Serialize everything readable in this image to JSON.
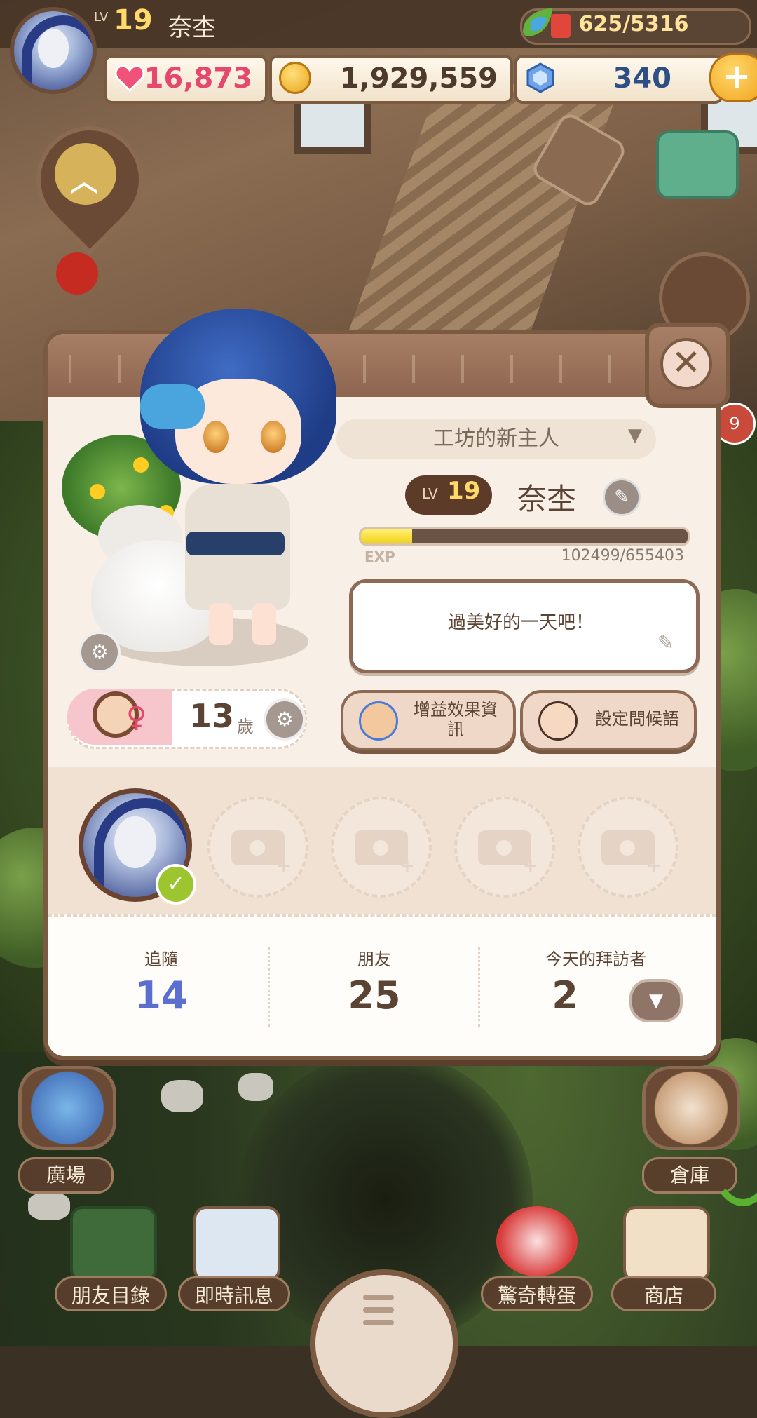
{
  "hud": {
    "level_prefix": "LV",
    "level": "19",
    "player_name": "奈杢",
    "energy": "625/5316",
    "energy_fraction": 0.117,
    "hearts": "16,873",
    "coins": "1,929,559",
    "gems": "340",
    "add_label": "+"
  },
  "profile": {
    "title": "工坊的新主人",
    "level_prefix": "LV",
    "level": "19",
    "name": "奈杢",
    "exp_label": "EXP",
    "exp": "102499/655403",
    "exp_fraction": 0.156,
    "greeting": "過美好的一天吧！",
    "age": "13",
    "age_unit": "歲",
    "buff_button": "增益效果資訊",
    "greeting_button": "設定問候語"
  },
  "stats": {
    "follow_label": "追隨",
    "follow_value": "14",
    "friends_label": "朋友",
    "friends_value": "25",
    "visitors_label": "今天的拜訪者",
    "visitors_value": "2"
  },
  "side": {
    "plaza": "廣場",
    "warehouse": "倉庫",
    "badge": "9"
  },
  "nav": {
    "friends_list": "朋友目錄",
    "messages": "即時訊息",
    "gacha": "驚奇轉蛋",
    "shop": "商店"
  },
  "colors": {
    "accent_brown": "#7b5a42",
    "heart_pink": "#e5476d",
    "gem_blue": "#2d4f86",
    "follow_blue": "#5b6fd0",
    "exp_yellow": "#f1d21a"
  },
  "icons": {
    "energy": "leaf-drop-icon",
    "heart": "heart-icon",
    "coin": "coin-icon",
    "gem": "gem-icon",
    "close": "close-icon",
    "edit": "pencil-icon",
    "settings": "gear-icon",
    "dropdown": "chevron-down-icon",
    "photo": "camera-add-icon",
    "check": "check-icon"
  }
}
